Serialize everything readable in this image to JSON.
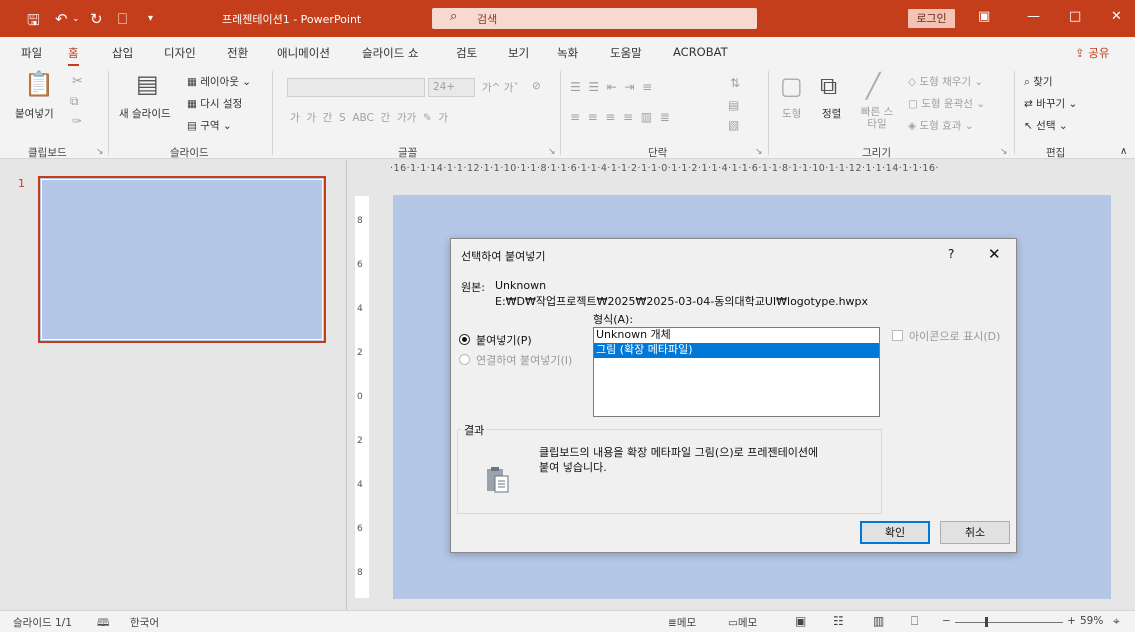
{
  "titlebar": {
    "title": "프레젠테이션1 - PowerPoint",
    "search_placeholder": "검색",
    "login_label": "로그인",
    "icons": [
      "save-icon",
      "undo-icon",
      "redo-icon",
      "slideshow-icon",
      "customize-icon",
      "ribbon-display-icon",
      "minimize-icon",
      "maximize-icon",
      "close-icon"
    ]
  },
  "menu": {
    "tabs": [
      "파일",
      "홈",
      "삽입",
      "디자인",
      "전환",
      "애니메이션",
      "슬라이드 쇼",
      "검토",
      "보기",
      "녹화",
      "도움말",
      "ACROBAT"
    ],
    "active": "홈",
    "share_label": "공유"
  },
  "ribbon": {
    "clipboard": {
      "paste": "붙여넣기",
      "group": "클립보드"
    },
    "slides": {
      "new_slide": "새 슬라이드",
      "layout": "레이아웃",
      "reset": "다시 설정",
      "section": "구역",
      "group": "슬라이드"
    },
    "font": {
      "size": "24+",
      "group": "글꼴"
    },
    "paragraph": {
      "group": "단락"
    },
    "drawing": {
      "shape": "도형",
      "arrange": "정렬",
      "quick_styles": "빠른 스타일",
      "fill": "도형 채우기",
      "outline": "도형 윤곽선",
      "effects": "도형 효과",
      "group": "그리기"
    },
    "editing": {
      "find": "찾기",
      "replace": "바꾸기",
      "select": "선택",
      "group": "편집"
    }
  },
  "thumbnails": {
    "slide_number": "1"
  },
  "ruler": {
    "horizontal": "·16·1·1·14·1·1·12·1·1·10·1·1·8·1·1·6·1·1·4·1·1·2·1·1·0·1·1·2·1·1·4·1·1·6·1·1·8·1·1·10·1·1·12·1·1·14·1·1·16·",
    "vertical": [
      "8",
      "6",
      "4",
      "2",
      "0",
      "2",
      "4",
      "6",
      "8"
    ]
  },
  "dialog": {
    "title": "선택하여 붙여넣기",
    "source_label": "원본:",
    "source_name": "Unknown",
    "source_path": "E:₩D₩작업프로젝트₩2025₩2025-03-04-동의대학교UI₩logotype.hwpx",
    "format_label": "형식(A):",
    "radio_paste": "붙여넣기(P)",
    "radio_paste_link": "연결하여 붙여넣기(I)",
    "formats": [
      "Unknown 개체",
      "그림 (확장 메타파일)"
    ],
    "selected_format_index": 1,
    "display_as_icon": "아이콘으로 표시(D)",
    "result_label": "결과",
    "result_text_line1": "클립보드의 내용을 확장 메타파일 그림(으)로 프레젠테이션에",
    "result_text_line2": "붙여 넣습니다.",
    "ok_label": "확인",
    "cancel_label": "취소",
    "help": "?"
  },
  "status": {
    "slide_info": "슬라이드 1/1",
    "language": "한국어",
    "notes": "메모",
    "comments": "메모",
    "zoom": "59%"
  },
  "colors": {
    "accent": "#c43e1c",
    "slide_bg": "#b4c7e7",
    "selection": "#0078d7"
  }
}
